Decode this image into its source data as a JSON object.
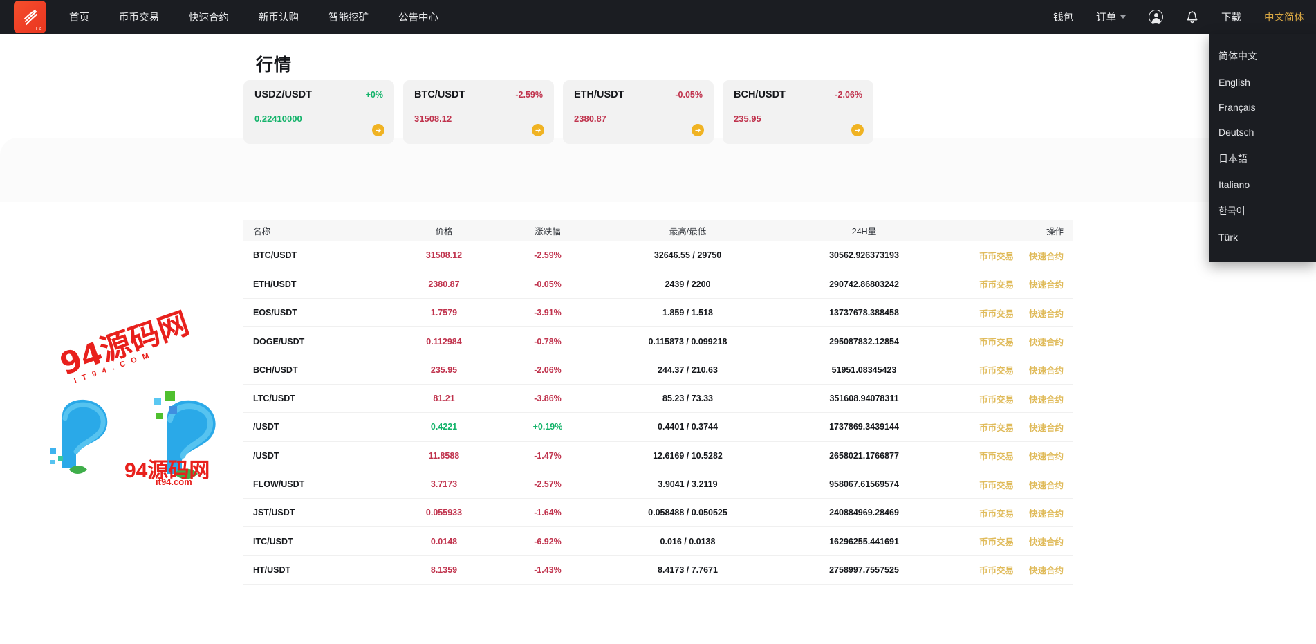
{
  "nav": {
    "logo_sub": "LA",
    "links": [
      {
        "label": "首页"
      },
      {
        "label": "币币交易"
      },
      {
        "label": "快速合约"
      },
      {
        "label": "新币认购"
      },
      {
        "label": "智能挖矿"
      },
      {
        "label": "公告中心"
      }
    ],
    "right": {
      "wallet": "钱包",
      "orders": "订单",
      "download": "下载",
      "language": "中文简体"
    }
  },
  "language_menu": {
    "items": [
      {
        "label": "简体中文"
      },
      {
        "label": "English"
      },
      {
        "label": "Français"
      },
      {
        "label": "Deutsch"
      },
      {
        "label": "日本語"
      },
      {
        "label": "Italiano"
      },
      {
        "label": "한국어"
      },
      {
        "label": "Türk"
      }
    ]
  },
  "page": {
    "title": "行情"
  },
  "cards": [
    {
      "pair": "USDZ/USDT",
      "change": "+0%",
      "price": "0.22410000",
      "dir": "up"
    },
    {
      "pair": "BTC/USDT",
      "change": "-2.59%",
      "price": "31508.12",
      "dir": "down"
    },
    {
      "pair": "ETH/USDT",
      "change": "-0.05%",
      "price": "2380.87",
      "dir": "down"
    },
    {
      "pair": "BCH/USDT",
      "change": "-2.06%",
      "price": "235.95",
      "dir": "down"
    }
  ],
  "table": {
    "headers": {
      "name": "名称",
      "price": "价格",
      "change": "涨跌幅",
      "high_low": "最高/最低",
      "volume": "24H量",
      "action": "操作"
    },
    "actions": {
      "spot": "币币交易",
      "contract": "快速合约"
    },
    "rows": [
      {
        "name": "BTC/USDT",
        "price": "31508.12",
        "change": "-2.59%",
        "high_low": "32646.55 / 29750",
        "volume": "30562.926373193",
        "dir": "down"
      },
      {
        "name": "ETH/USDT",
        "price": "2380.87",
        "change": "-0.05%",
        "high_low": "2439 / 2200",
        "volume": "290742.86803242",
        "dir": "down"
      },
      {
        "name": "EOS/USDT",
        "price": "1.7579",
        "change": "-3.91%",
        "high_low": "1.859 / 1.518",
        "volume": "13737678.388458",
        "dir": "down"
      },
      {
        "name": "DOGE/USDT",
        "price": "0.112984",
        "change": "-0.78%",
        "high_low": "0.115873 / 0.099218",
        "volume": "295087832.12854",
        "dir": "down"
      },
      {
        "name": "BCH/USDT",
        "price": "235.95",
        "change": "-2.06%",
        "high_low": "244.37 / 210.63",
        "volume": "51951.08345423",
        "dir": "down"
      },
      {
        "name": "LTC/USDT",
        "price": "81.21",
        "change": "-3.86%",
        "high_low": "85.23 / 73.33",
        "volume": "351608.94078311",
        "dir": "down"
      },
      {
        "name": "/USDT",
        "price": "0.4221",
        "change": "+0.19%",
        "high_low": "0.4401 / 0.3744",
        "volume": "1737869.3439144",
        "dir": "up"
      },
      {
        "name": "/USDT",
        "price": "11.8588",
        "change": "-1.47%",
        "high_low": "12.6169 / 10.5282",
        "volume": "2658021.1766877",
        "dir": "down"
      },
      {
        "name": "FLOW/USDT",
        "price": "3.7173",
        "change": "-2.57%",
        "high_low": "3.9041 / 3.2119",
        "volume": "958067.61569574",
        "dir": "down"
      },
      {
        "name": "JST/USDT",
        "price": "0.055933",
        "change": "-1.64%",
        "high_low": "0.058488 / 0.050525",
        "volume": "240884969.28469",
        "dir": "down"
      },
      {
        "name": "ITC/USDT",
        "price": "0.0148",
        "change": "-6.92%",
        "high_low": "0.016 / 0.0138",
        "volume": "16296255.441691",
        "dir": "down"
      },
      {
        "name": "HT/USDT",
        "price": "8.1359",
        "change": "-1.43%",
        "high_low": "8.4173 / 7.7671",
        "volume": "2758997.7557525",
        "dir": "down"
      }
    ]
  },
  "watermark": {
    "line1": "94源码网",
    "line1_sub": "IT94.COM",
    "line2": "94源码网",
    "line3": "it94.com"
  },
  "colors": {
    "nav_bg": "#1b1d22",
    "accent_gold": "#d8a743",
    "up_green": "#13b36a",
    "down_red": "#c0334d",
    "card_bg": "#f2f2f2",
    "arrow_yellow": "#f0b323",
    "watermark_red": "#e8201c"
  }
}
